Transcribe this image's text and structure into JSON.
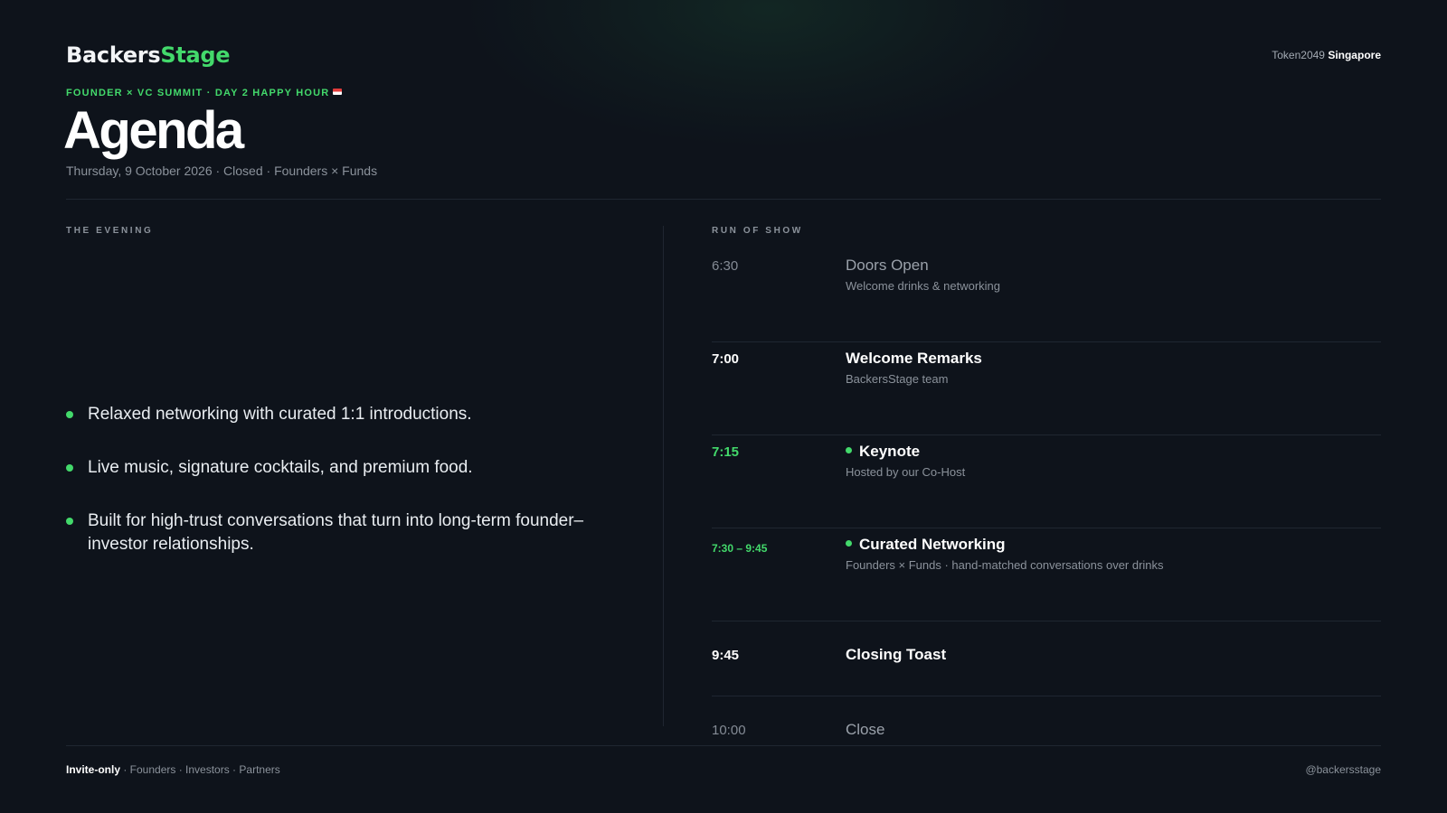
{
  "brand": {
    "part1": "Backers",
    "part2": "Stage",
    "accent": "#43d96b"
  },
  "event_tag": {
    "token": "Token2049",
    "city": "Singapore"
  },
  "eyebrow": "FOUNDER × VC SUMMIT · DAY 2 HAPPY HOUR",
  "title": "Agenda",
  "subtitle": "Thursday, 9 October 2026 · Closed · Founders × Funds",
  "evening": {
    "label": "THE EVENING",
    "bullets": [
      "Relaxed networking with curated 1:1 introductions.",
      "Live music, signature cocktails, and premium food.",
      "Built for high-trust conversations that turn into long-term founder–investor relationships."
    ]
  },
  "run_of_show": {
    "label": "RUN OF SHOW",
    "items": [
      {
        "time": "6:30",
        "title": "Doors Open",
        "desc": "Welcome drinks & networking"
      },
      {
        "time": "7:00",
        "title": "Welcome Remarks",
        "desc": "BackersStage team"
      },
      {
        "time": "7:15",
        "title": "Keynote",
        "desc": "Hosted by our Co-Host"
      },
      {
        "time": "7:30 – 9:45",
        "title": "Curated Networking",
        "desc": "Founders × Funds · hand-matched conversations over drinks"
      },
      {
        "time": "9:45",
        "title": "Closing Toast"
      },
      {
        "time": "10:00",
        "title": "Close"
      }
    ]
  },
  "footer": {
    "lead": "Invite-only",
    "rest": " · Founders · Investors · Partners",
    "handle": "@backersstage"
  }
}
